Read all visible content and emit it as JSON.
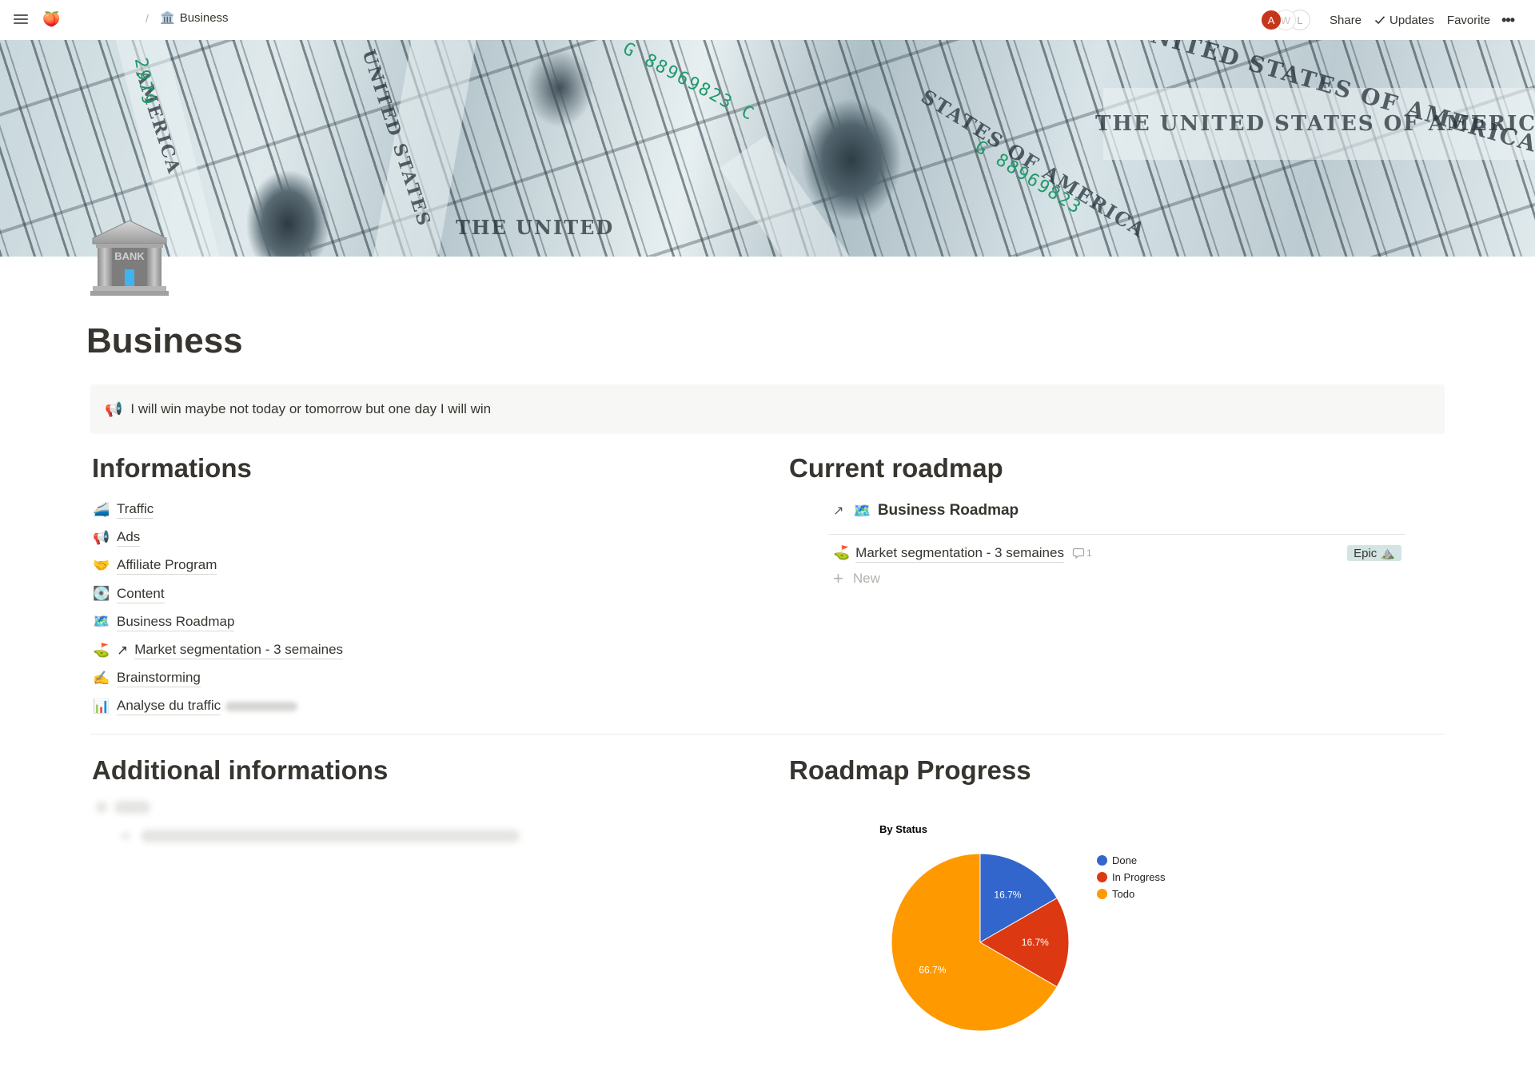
{
  "topbar": {
    "workspace_icon": "🍑",
    "breadcrumb_separator": "/",
    "breadcrumb": [
      {
        "icon": "🏛️",
        "label": "Business"
      }
    ],
    "avatars": [
      "A",
      "W",
      "L"
    ],
    "share_label": "Share",
    "updates_label": "Updates",
    "favorite_label": "Favorite",
    "more_label": "•••"
  },
  "page": {
    "icon": "bank-building-icon",
    "title": "Business",
    "callout": {
      "icon": "📢",
      "text": "I will win maybe not today or tomorrow but one day I will win"
    }
  },
  "informations": {
    "heading": "Informations",
    "links": [
      {
        "icon": "🚄",
        "label": "Traffic",
        "arrow": false
      },
      {
        "icon": "📢",
        "label": "Ads",
        "arrow": false
      },
      {
        "icon": "🤝",
        "label": "Affiliate Program",
        "arrow": false
      },
      {
        "icon": "💽",
        "label": "Content",
        "arrow": false
      },
      {
        "icon": "🗺️",
        "label": "Business Roadmap",
        "arrow": false
      },
      {
        "icon": "⛳",
        "label": "Market segmentation - 3 semaines",
        "arrow": true,
        "arrow_glyph": "↗"
      },
      {
        "icon": "✍️",
        "label": "Brainstorming",
        "arrow": false
      },
      {
        "icon": "📊",
        "label": "Analyse du traffic",
        "arrow": false,
        "redacted_suffix": true
      }
    ]
  },
  "roadmap": {
    "heading": "Current roadmap",
    "database": {
      "link_arrow": "↗",
      "icon": "🗺️",
      "title": "Business Roadmap",
      "rows": [
        {
          "icon": "⛳",
          "name": "Market segmentation - 3 semaines",
          "comment_count": "1",
          "tag": {
            "label": "Epic",
            "icon": "⛰️",
            "color": "#d3e5e2"
          }
        }
      ],
      "new_label": "New"
    }
  },
  "additional": {
    "heading": "Additional informations",
    "content_redacted": true
  },
  "progress": {
    "heading": "Roadmap Progress"
  },
  "chart_data": {
    "type": "pie",
    "title": "By Status",
    "legend_position": "right",
    "categories": [
      "Done",
      "In Progress",
      "Todo"
    ],
    "values": [
      16.7,
      16.7,
      66.7
    ],
    "labels": [
      "16.7%",
      "16.7%",
      "66.7%"
    ],
    "colors": [
      "#3366cc",
      "#dc3912",
      "#ff9900"
    ]
  }
}
